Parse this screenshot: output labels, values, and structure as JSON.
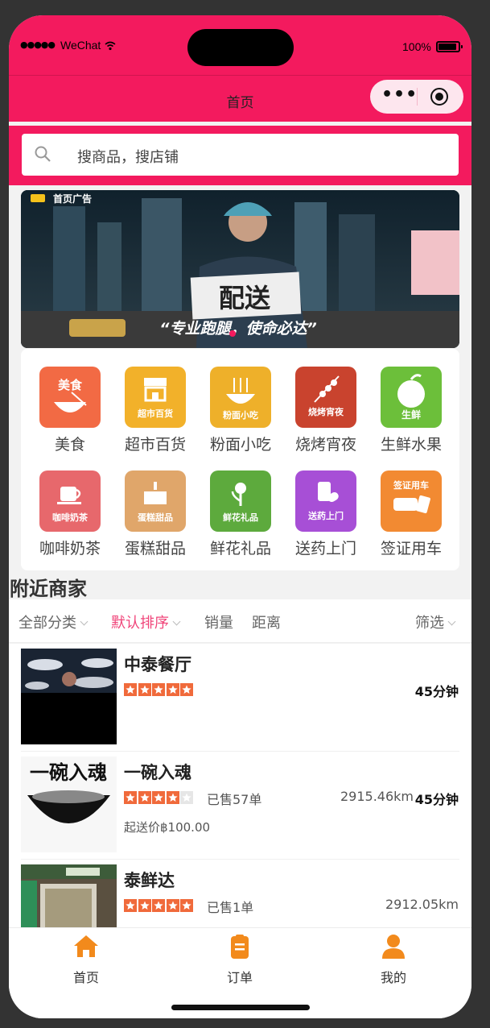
{
  "status_bar": {
    "carrier": "WeChat",
    "battery": "100%"
  },
  "navbar": {
    "title": "首页"
  },
  "search": {
    "placeholder": "搜商品，搜店铺"
  },
  "banner": {
    "tag": "首页广告",
    "sign_text": "配送",
    "slogan": "“专业跑腿，使命必达”"
  },
  "categories": [
    {
      "label": "美食",
      "icon": "food-bowl-icon",
      "icon_text": "美食",
      "color": "#f26a44"
    },
    {
      "label": "超市百货",
      "icon": "store-icon",
      "icon_text": "超市百货",
      "color": "#f2b12a"
    },
    {
      "label": "粉面小吃",
      "icon": "noodle-icon",
      "icon_text": "粉面小吃",
      "color": "#eeb02a"
    },
    {
      "label": "烧烤宵夜",
      "icon": "skewer-icon",
      "icon_text": "烧烤宵夜",
      "color": "#c9432e"
    },
    {
      "label": "生鲜水果",
      "icon": "fruit-icon",
      "icon_text": "生鲜",
      "color": "#6cbf3a"
    },
    {
      "label": "咖啡奶茶",
      "icon": "coffee-icon",
      "icon_text": "咖啡奶茶",
      "color": "#e7686c"
    },
    {
      "label": "蛋糕甜品",
      "icon": "cake-icon",
      "icon_text": "蛋糕甜品",
      "color": "#e0a66a"
    },
    {
      "label": "鲜花礼品",
      "icon": "flower-icon",
      "icon_text": "鲜花礼品",
      "color": "#5daa3d"
    },
    {
      "label": "送药上门",
      "icon": "medicine-icon",
      "icon_text": "送药上门",
      "color": "#a74fd6"
    },
    {
      "label": "签证用车",
      "icon": "car-icon",
      "icon_text": "签证用车",
      "color": "#f28a32"
    }
  ],
  "nearby": {
    "title": "附近商家",
    "filters": {
      "all": "全部分类",
      "default_sort": "默认排序",
      "sales": "销量",
      "distance": "距离",
      "filter": "筛选"
    }
  },
  "shops": [
    {
      "name": "中泰餐厅",
      "rating": 5,
      "sold": "",
      "distance": "",
      "time": "45分钟",
      "min_price": ""
    },
    {
      "name": "一碗入魂",
      "rating": 4,
      "sold": "已售57单",
      "distance": "2915.46km",
      "time": "45分钟",
      "min_price": "起送价฿100.00",
      "img_text": "一碗入魂"
    },
    {
      "name": "泰鲜达",
      "rating": 5,
      "sold": "已售1单",
      "distance": "2912.05km",
      "time": "",
      "min_price": ""
    }
  ],
  "tabbar": {
    "home": "首页",
    "orders": "订单",
    "mine": "我的"
  },
  "colors": {
    "brand": "#f31a5e",
    "accent_orange": "#f28a1c",
    "star": "#f06a3b",
    "active_filter": "#f0457a"
  }
}
